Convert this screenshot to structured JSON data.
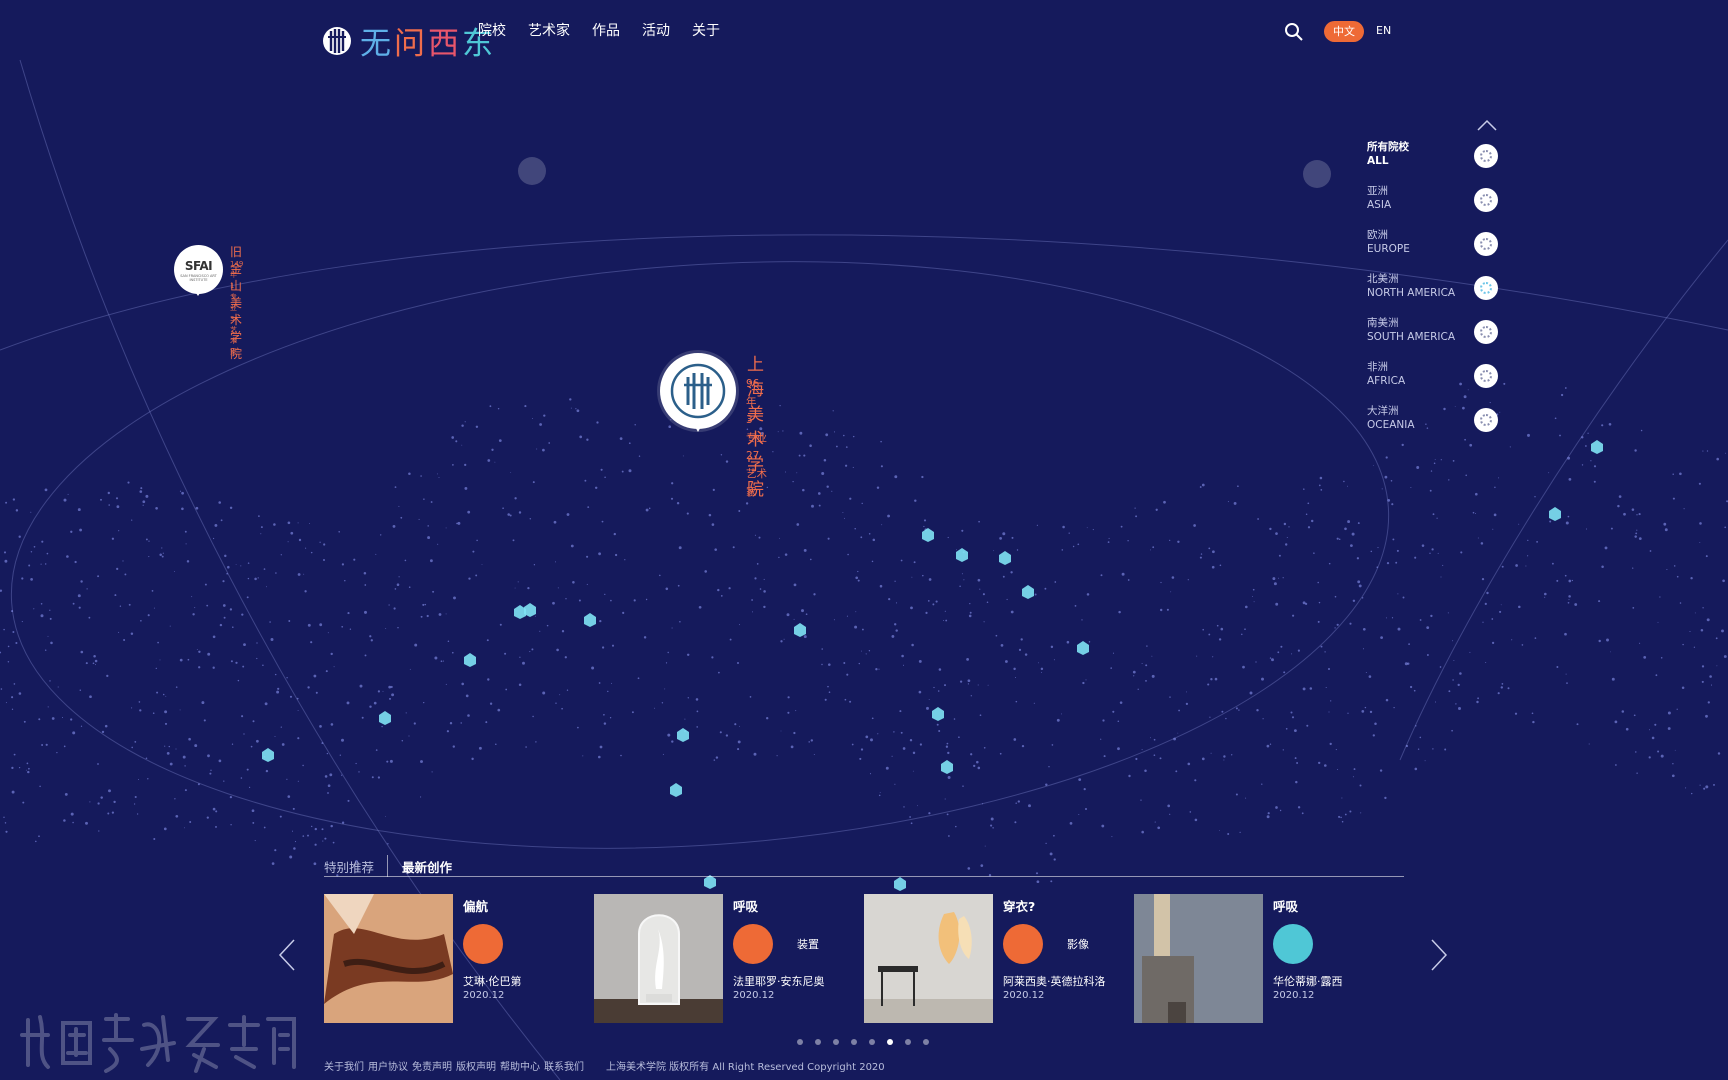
{
  "brand": {
    "logo_text_1": "无",
    "logo_text_2": "问",
    "logo_text_3": "西",
    "logo_text_4": "东"
  },
  "nav": {
    "items": [
      "院校",
      "艺术家",
      "作品",
      "活动",
      "关于"
    ]
  },
  "header": {
    "lang_zh": "中文",
    "lang_en": "EN"
  },
  "map": {
    "main_school": {
      "name": "上海美术学院",
      "years": "96",
      "years_unit": "年",
      "majors": "3",
      "majors_unit": "专业",
      "artists": "27",
      "artists_unit": "艺术家"
    },
    "side_school": {
      "name": "旧金山美术学院",
      "logo_text": "SFAI",
      "logo_sub": "SAN FRANCISCO ART INSTITUTE",
      "years": "149",
      "years_unit": "年",
      "majors": "1",
      "majors_unit": "专业",
      "artists": "3",
      "artists_unit": "艺术家"
    }
  },
  "regions": [
    {
      "zh": "所有院校",
      "en": "ALL",
      "active": true
    },
    {
      "zh": "亚洲",
      "en": "ASIA",
      "active": false
    },
    {
      "zh": "欧洲",
      "en": "EUROPE",
      "active": false
    },
    {
      "zh": "北美洲",
      "en": "NORTH AMERICA",
      "active": false
    },
    {
      "zh": "南美洲",
      "en": "SOUTH AMERICA",
      "active": false
    },
    {
      "zh": "非洲",
      "en": "AFRICA",
      "active": false
    },
    {
      "zh": "大洋洲",
      "en": "OCEANIA",
      "active": false
    }
  ],
  "tabs": {
    "featured": "特别推荐",
    "latest": "最新创作"
  },
  "works": [
    {
      "title": "偏航",
      "type": "",
      "artist": "艾琳·伦巴第",
      "date": "2020.12",
      "color": "#ee6a36"
    },
    {
      "title": "呼吸",
      "type": "装置",
      "artist": "法里耶罗·安东尼奥",
      "date": "2020.12",
      "color": "#ee6a36"
    },
    {
      "title": "穿衣?",
      "type": "影像",
      "artist": "阿莱西奥·英德拉科洛",
      "date": "2020.12",
      "color": "#ee6a36"
    },
    {
      "title": "呼吸",
      "type": "",
      "artist": "华伦蒂娜·露西",
      "date": "2020.12",
      "color": "#4fc7d6"
    }
  ],
  "pager": {
    "count": 8,
    "active": 5
  },
  "footer": {
    "links": [
      "关于我们",
      "用户协议",
      "免责声明",
      "版权声明",
      "帮助中心",
      "联系我们"
    ],
    "copyright": "上海美术学院 版权所有 All Right Reserved Copyright 2020"
  },
  "colors": {
    "background": "#151a5c",
    "accent": "#ee6a36",
    "teal": "#4fc7d6"
  }
}
